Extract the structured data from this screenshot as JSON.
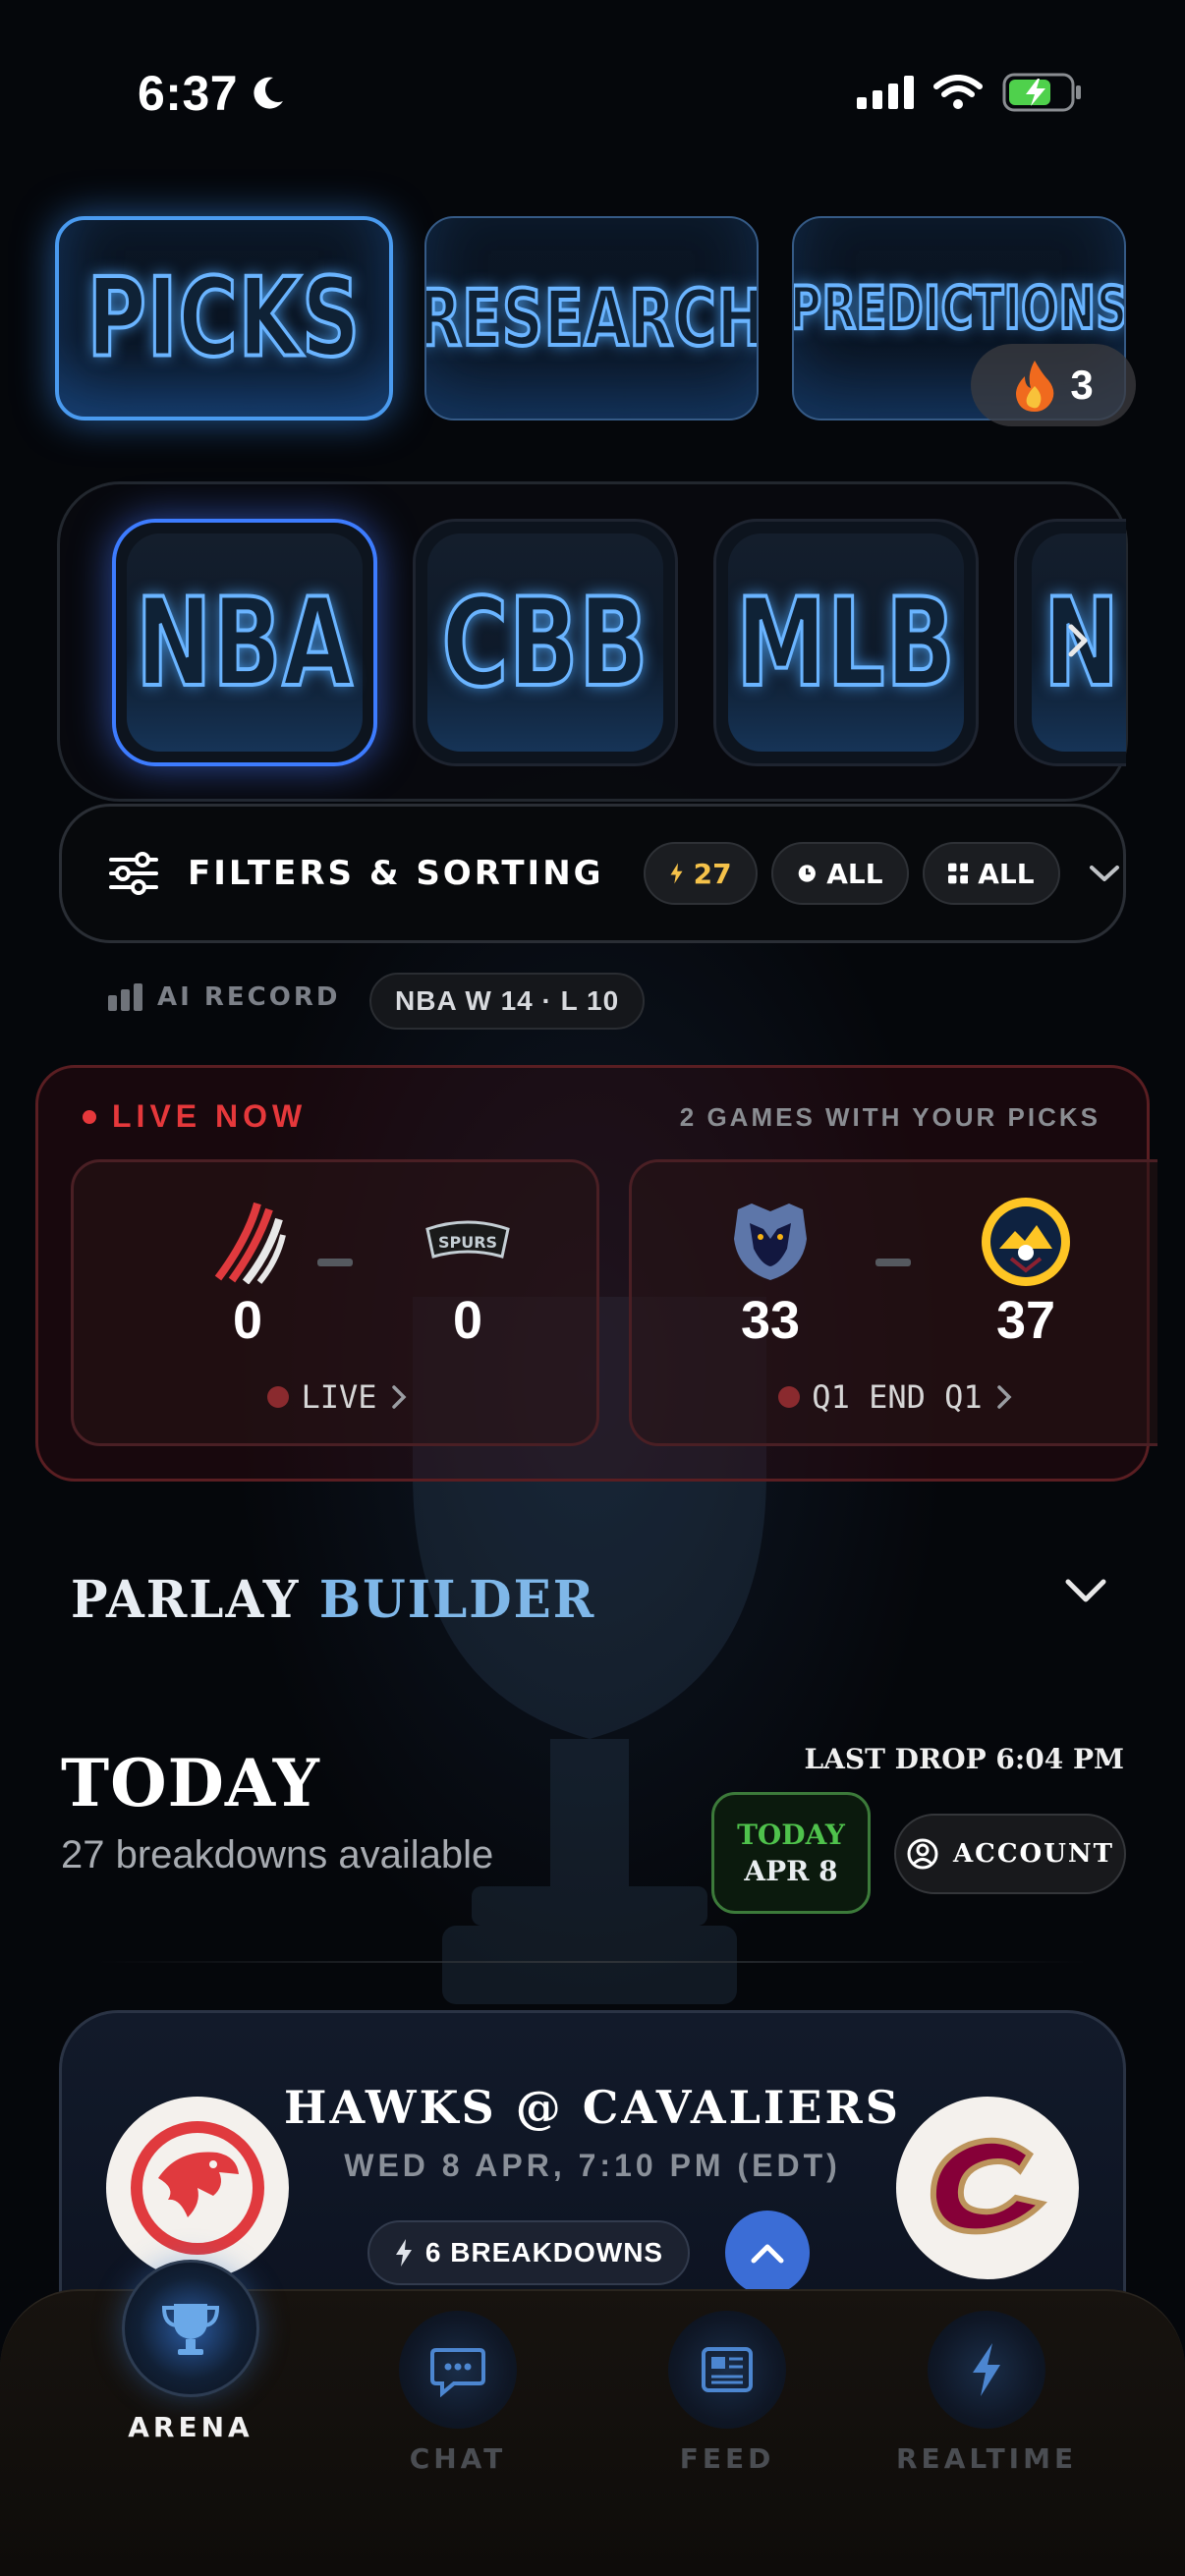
{
  "status": {
    "time": "6:37"
  },
  "top_tabs": [
    {
      "label": "PICKS"
    },
    {
      "label": "RESEARCH"
    },
    {
      "label": "PREDICTIONS"
    }
  ],
  "streak": {
    "count": "3"
  },
  "sports": [
    {
      "label": "NBA"
    },
    {
      "label": "CBB"
    },
    {
      "label": "MLB"
    },
    {
      "label": "N"
    }
  ],
  "filters": {
    "label": "FILTERS & SORTING",
    "count": "27",
    "time_chip": "ALL",
    "grid_chip": "ALL"
  },
  "ai_record": {
    "label": "AI RECORD",
    "value": "NBA  W 14 · L 10"
  },
  "live": {
    "title": "LIVE NOW",
    "subtitle": "2 GAMES WITH YOUR PICKS",
    "games": [
      {
        "home_score": "0",
        "away_score": "0",
        "status": "LIVE",
        "away_logo_text": "SPURS"
      },
      {
        "home_score": "33",
        "away_score": "37",
        "status": "Q1 END Q1"
      }
    ]
  },
  "parlay": {
    "word1": "PARLAY",
    "word2": "BUILDER"
  },
  "today": {
    "title": "TODAY",
    "subtitle": "27 breakdowns available",
    "last_drop": "LAST DROP 6:04 PM",
    "badge_top": "TODAY",
    "badge_bottom": "APR 8",
    "account": "ACCOUNT"
  },
  "matchup": {
    "title": "HAWKS @ CAVALIERS",
    "time": "WED 8 APR, 7:10 PM (EDT)",
    "breakdowns": "6 BREAKDOWNS"
  },
  "nav": [
    {
      "label": "ARENA"
    },
    {
      "label": "CHAT"
    },
    {
      "label": "FEED"
    },
    {
      "label": "REALTIME"
    }
  ],
  "colors": {
    "accent_blue": "#4a9bf0",
    "live_red": "#e5383b",
    "today_green": "#4fc24c",
    "gold": "#f5c24a"
  }
}
